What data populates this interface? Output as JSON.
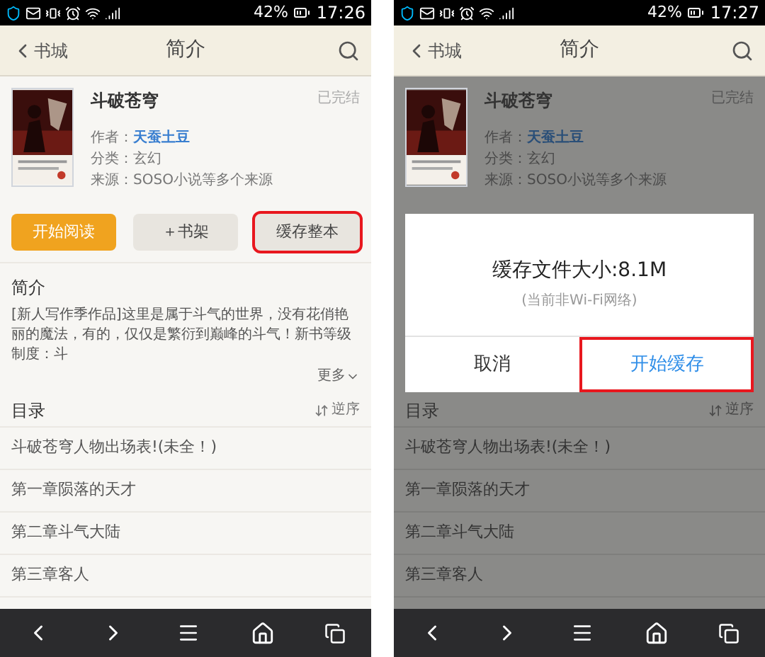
{
  "screens": [
    {
      "status_bar": {
        "battery": "42%",
        "time": "17:26"
      },
      "header": {
        "back": "书城",
        "title": "简介"
      },
      "book": {
        "title": "斗破苍穹",
        "status": "已完结",
        "author_label": "作者：",
        "author": "天蚕土豆",
        "category": "分类：玄幻",
        "source": "来源：SOSO小说等多个来源"
      },
      "buttons": [
        {
          "label": "开始阅读",
          "kind": "primary",
          "highlighted": false
        },
        {
          "label": "＋书架",
          "kind": "plain",
          "highlighted": false
        },
        {
          "label": "缓存整本",
          "kind": "plain",
          "highlighted": true
        }
      ],
      "intro": {
        "heading": "简介",
        "text": "[新人写作季作品]这里是属于斗气的世界，没有花俏艳丽的魔法，有的，仅仅是繁衍到巅峰的斗气！新书等级制度：斗",
        "more": "更多"
      },
      "toc": {
        "heading": "目录",
        "sort": "逆序",
        "chapters": [
          "斗破苍穹人物出场表!(未全！)",
          "第一章陨落的天才",
          "第二章斗气大陆",
          "第三章客人"
        ]
      }
    },
    {
      "status_bar": {
        "battery": "42%",
        "time": "17:27"
      },
      "header": {
        "back": "书城",
        "title": "简介"
      },
      "book": {
        "title": "斗破苍穹",
        "status": "已完结",
        "author_label": "作者：",
        "author": "天蚕土豆",
        "category": "分类：玄幻",
        "source": "来源：SOSO小说等多个来源"
      },
      "dialog": {
        "title": "缓存文件大小:8.1M",
        "note": "(当前非Wi-Fi网络)",
        "buttons": [
          {
            "label": "取消",
            "kind": "plain",
            "highlighted": false
          },
          {
            "label": "开始缓存",
            "kind": "primary",
            "highlighted": true
          }
        ]
      },
      "toc": {
        "heading": "目录",
        "sort": "逆序",
        "chapters": [
          "斗破苍穹人物出场表!(未全！)",
          "第一章陨落的天才",
          "第二章斗气大陆",
          "第三章客人"
        ]
      }
    }
  ]
}
